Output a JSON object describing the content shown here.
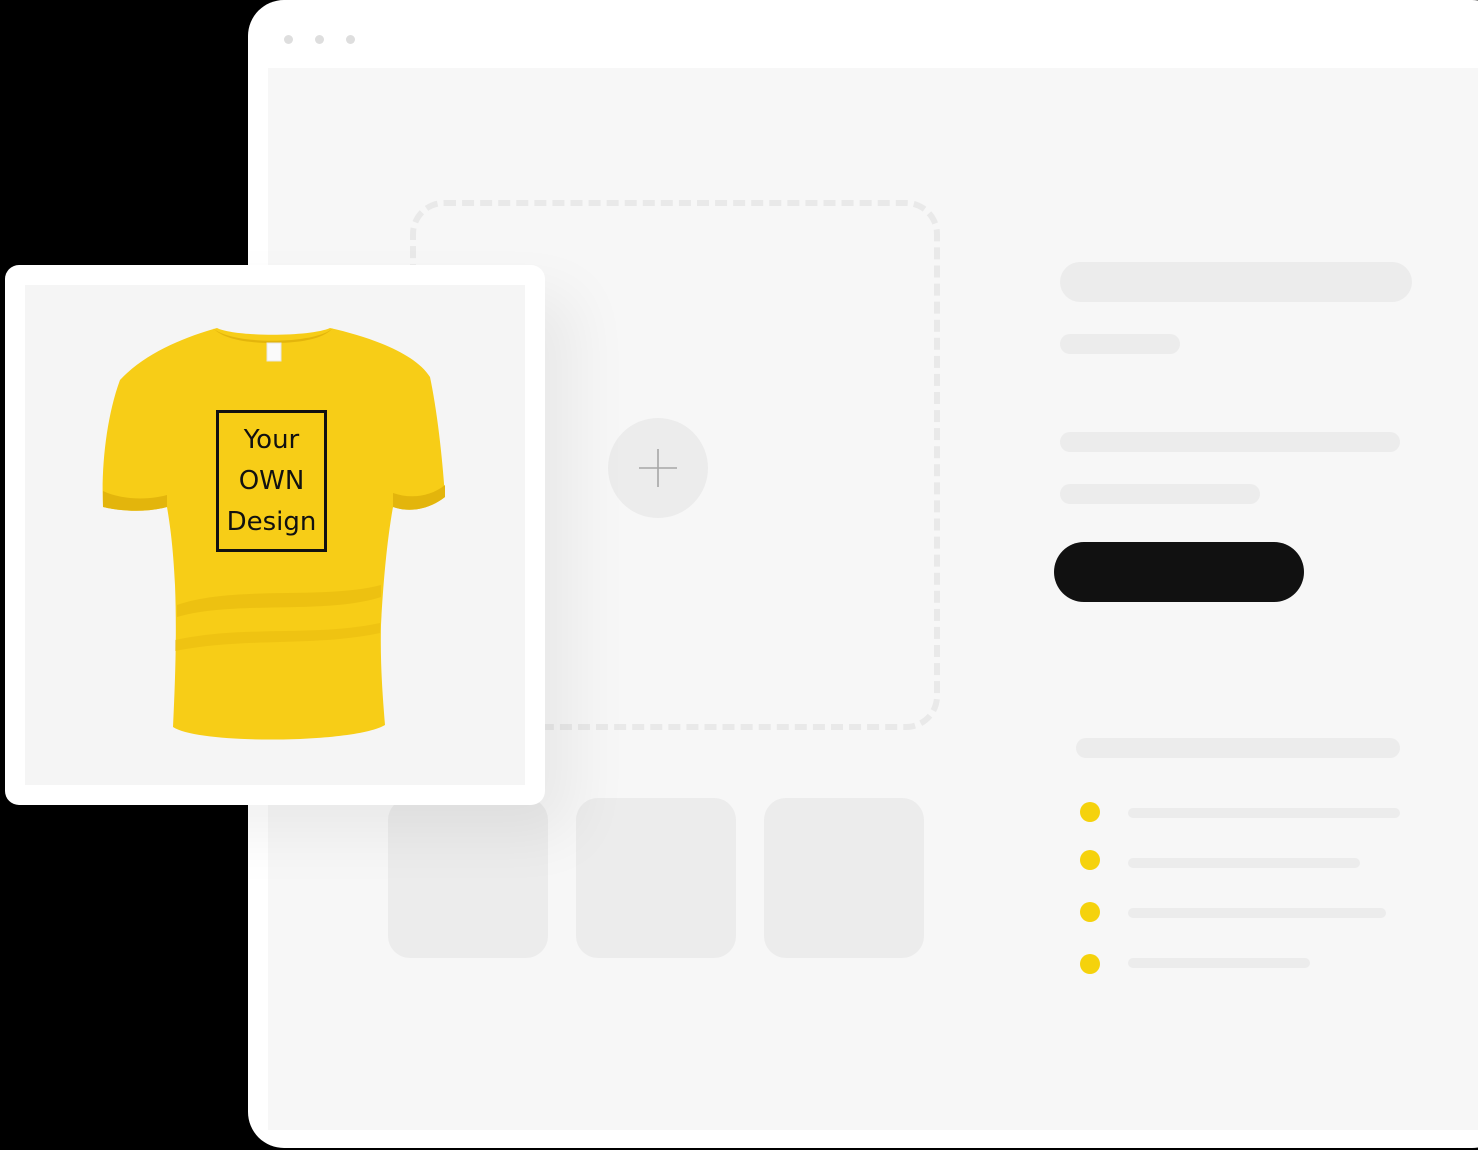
{
  "product": {
    "design_text": [
      "Your",
      "OWN",
      "Design"
    ],
    "shirt_color": "#f7cd17",
    "shirt_shadow_color": "#e3b50c",
    "image_background": "#f5f5f5"
  },
  "upload": {
    "icon": "plus-icon",
    "thumbnail_count": 3
  },
  "bullets": {
    "color": "#f5d20c",
    "count": 4
  },
  "cta": {
    "color": "#111111"
  },
  "colors": {
    "canvas": "#f7f7f7",
    "placeholder": "#ececec",
    "window": "#ffffff",
    "backdrop": "#000000"
  }
}
